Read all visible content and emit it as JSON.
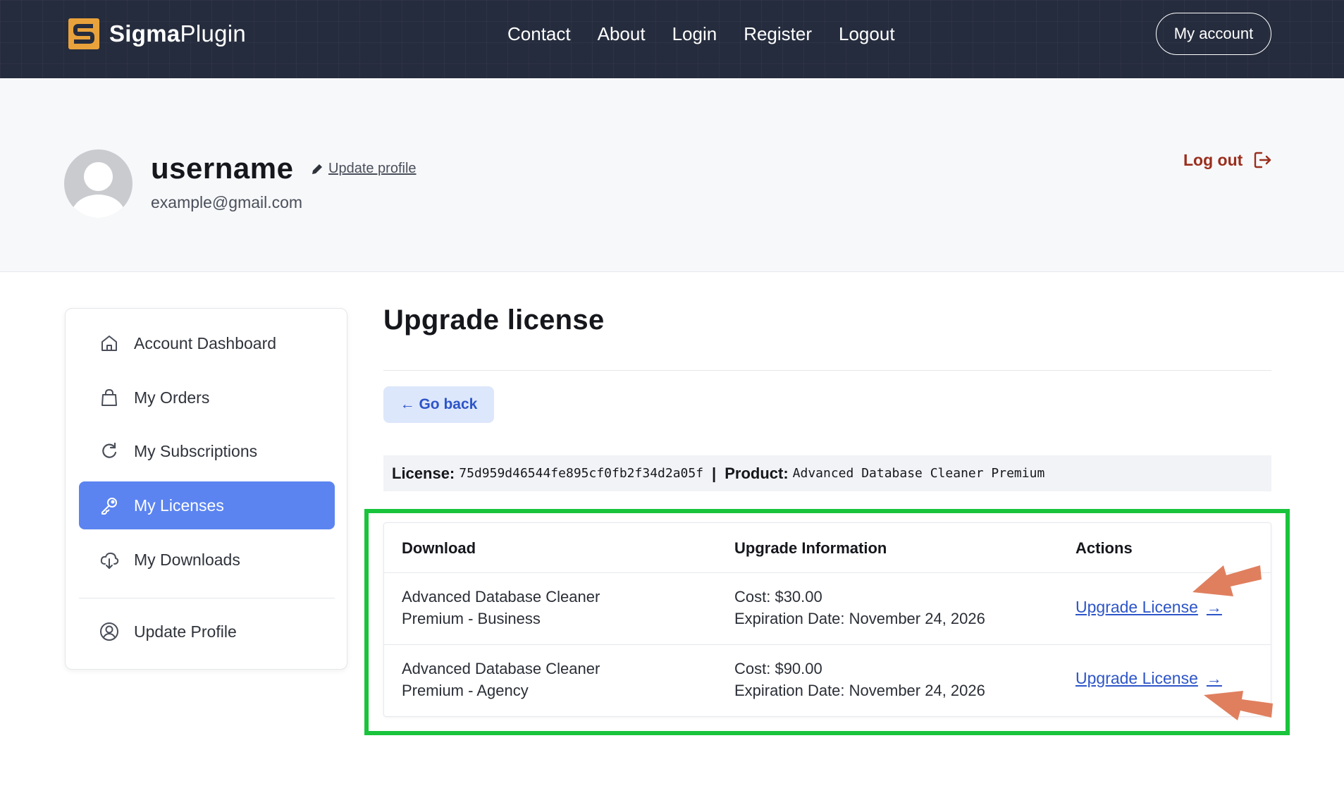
{
  "brand": {
    "name_bold": "Sigma",
    "name_light": "Plugin",
    "accent": "#e9a23b"
  },
  "nav": {
    "links": [
      "Contact",
      "About",
      "Login",
      "Register",
      "Logout"
    ],
    "account_button": "My account"
  },
  "profile": {
    "username": "username",
    "update_label": "Update profile",
    "email": "example@gmail.com",
    "logout_label": "Log out"
  },
  "sidebar": {
    "items": [
      {
        "label": "Account Dashboard",
        "icon": "home-icon"
      },
      {
        "label": "My Orders",
        "icon": "shopping-bag-icon"
      },
      {
        "label": "My Subscriptions",
        "icon": "refresh-icon"
      },
      {
        "label": "My Licenses",
        "icon": "key-icon",
        "active": true
      },
      {
        "label": "My Downloads",
        "icon": "cloud-download-icon"
      },
      {
        "label": "Update Profile",
        "icon": "user-circle-icon"
      }
    ],
    "active_color": "#5b84f0"
  },
  "main": {
    "title": "Upgrade license",
    "go_back": "← Go back",
    "license_label": "License:",
    "license_key": "75d959d46544fe895cf0fb2f34d2a05f",
    "separator": "|",
    "product_label": "Product:",
    "product_name": "Advanced Database Cleaner Premium"
  },
  "table": {
    "headers": [
      "Download",
      "Upgrade Information",
      "Actions"
    ],
    "rows": [
      {
        "download_line1": "Advanced Database Cleaner",
        "download_line2": "Premium - Business",
        "cost": "Cost: $30.00",
        "expiration": "Expiration Date: November 24, 2026",
        "action": "Upgrade License",
        "arrow": "→"
      },
      {
        "download_line1": "Advanced Database Cleaner",
        "download_line2": "Premium - Agency",
        "cost": "Cost: $90.00",
        "expiration": "Expiration Date: November 24, 2026",
        "action": "Upgrade License",
        "arrow": "→"
      }
    ]
  },
  "annotations": {
    "highlight_color": "#19c43c",
    "arrow_color": "#e07f5e"
  }
}
